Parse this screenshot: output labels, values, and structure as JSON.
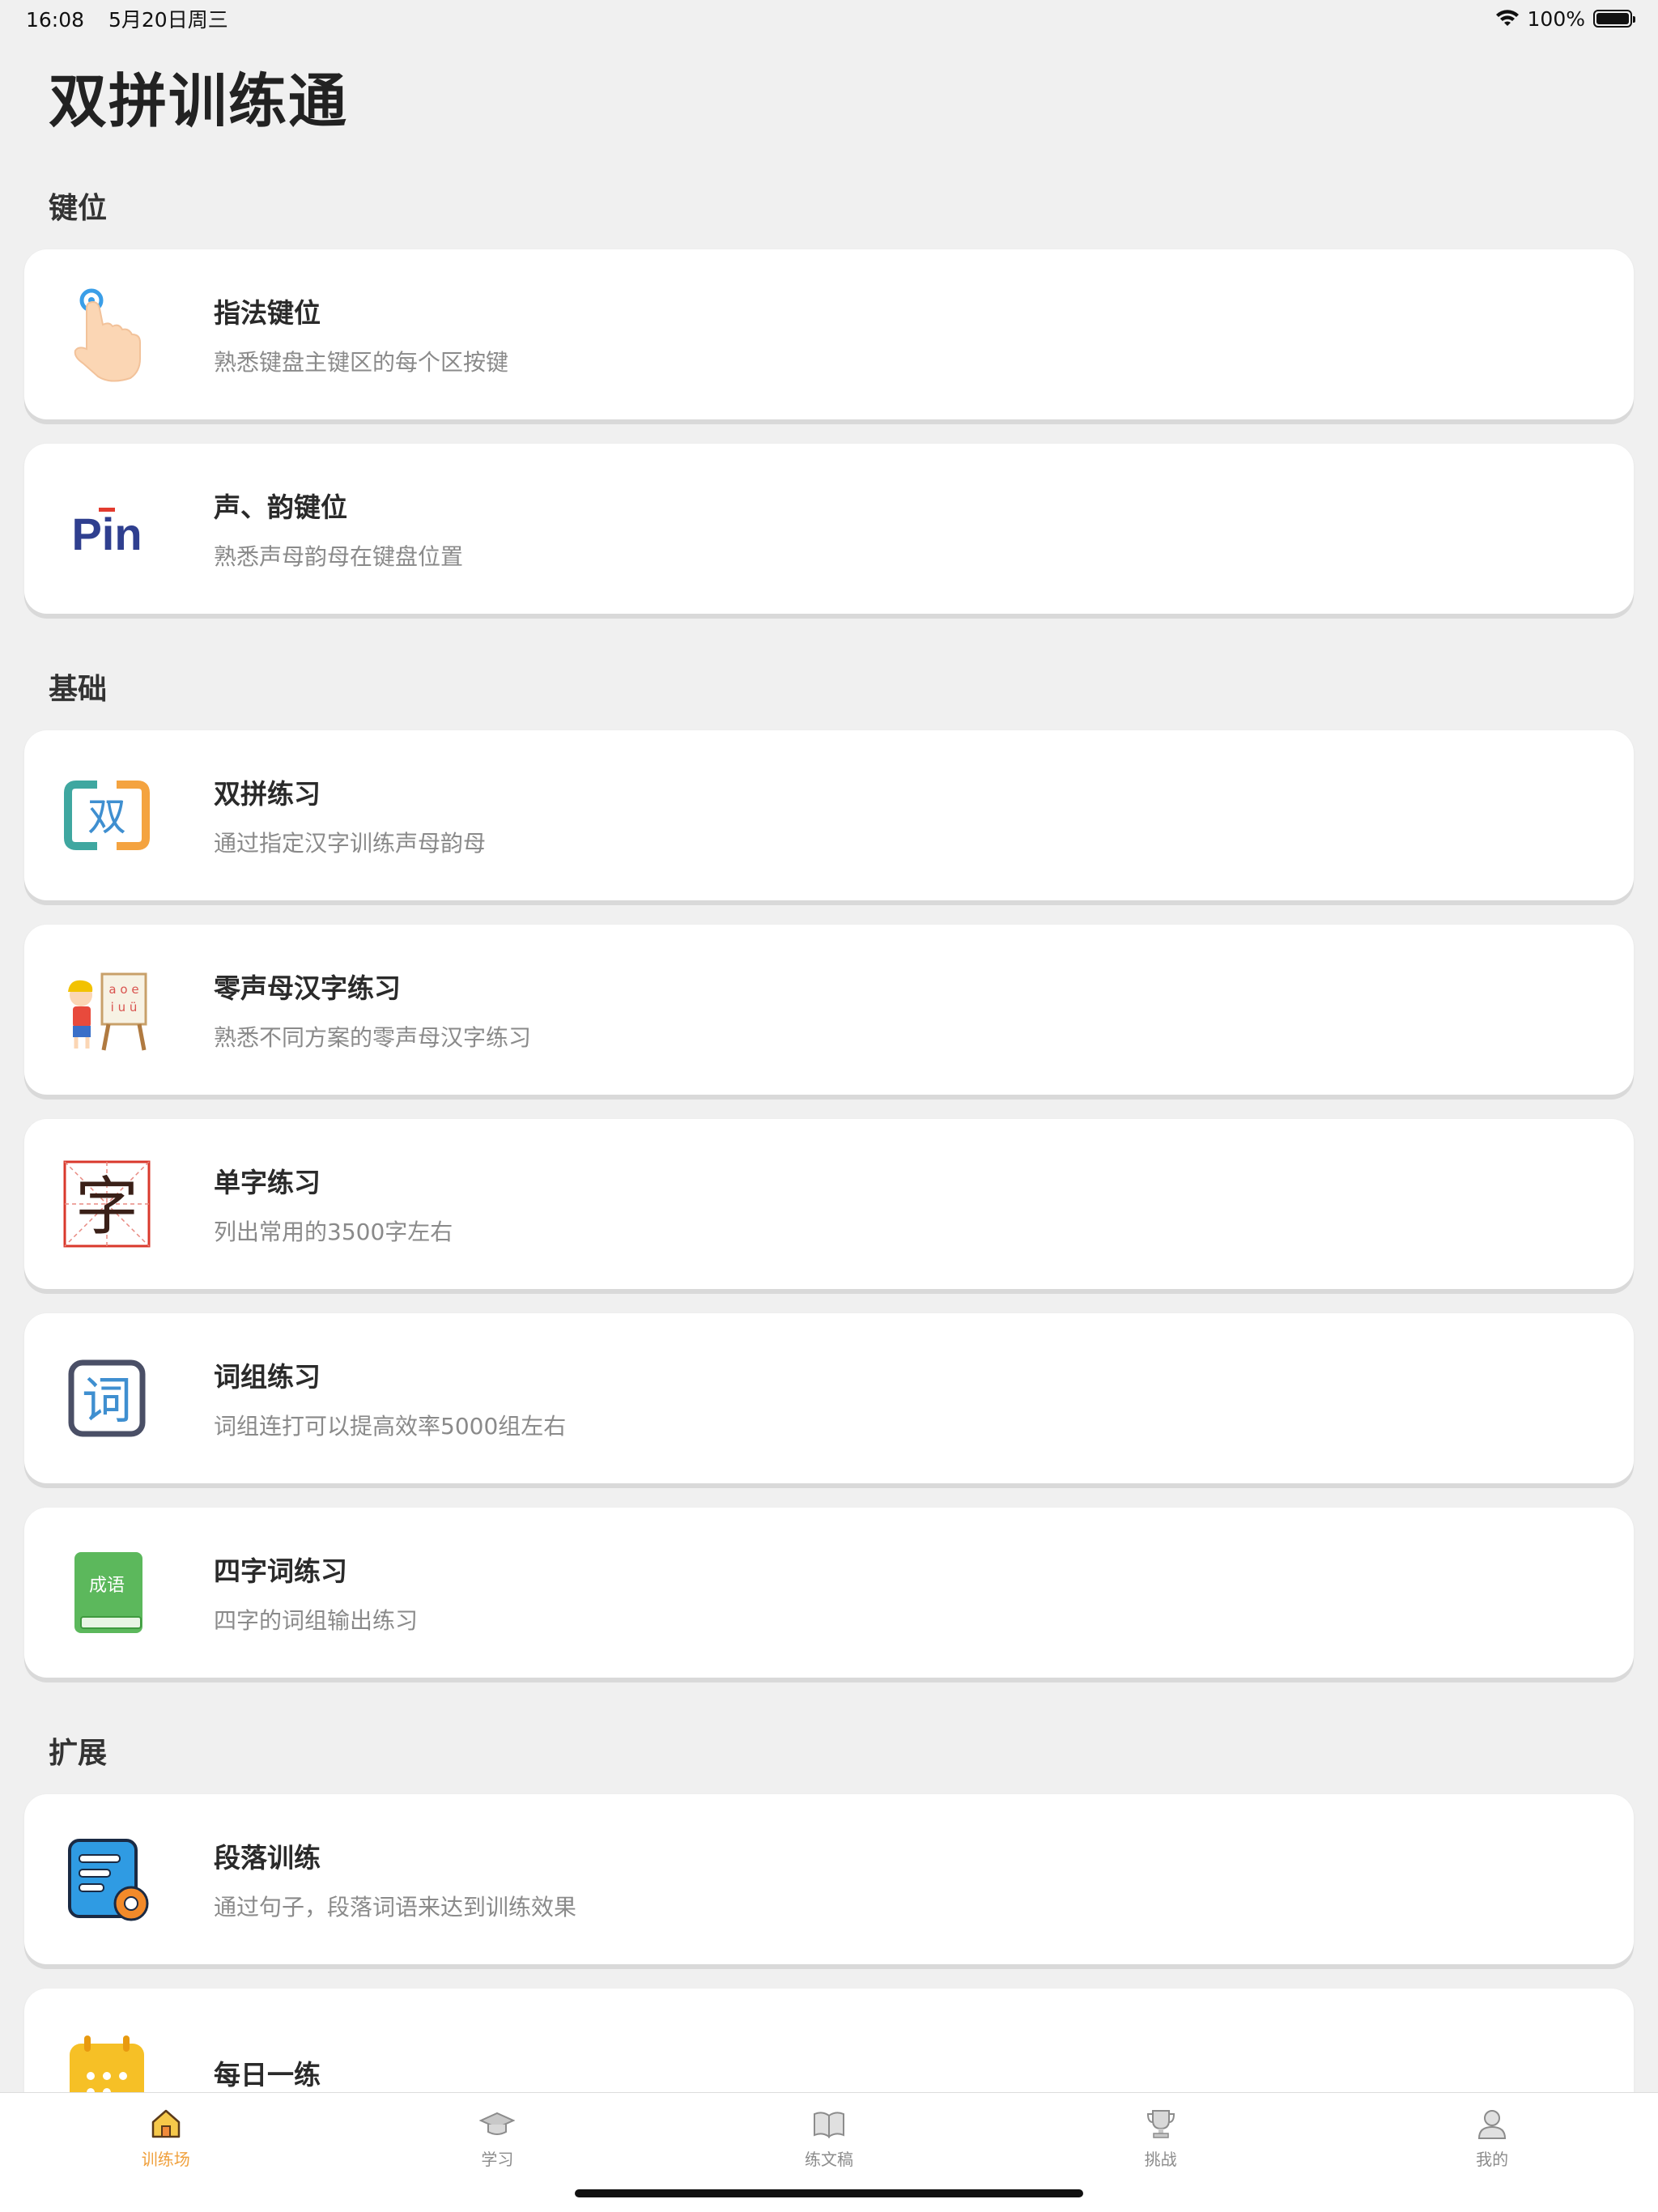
{
  "status": {
    "time": "16:08",
    "date": "5月20日周三",
    "battery": "100%"
  },
  "app": {
    "title": "双拼训练通"
  },
  "sections": {
    "keys": "键位",
    "basics": "基础",
    "extend": "扩展"
  },
  "cards": {
    "finger": {
      "title": "指法键位",
      "sub": "熟悉键盘主键区的每个区按键",
      "icon": "finger-tap-icon"
    },
    "initials": {
      "title": "声、韵键位",
      "sub": "熟悉声母韵母在键盘位置",
      "icon": "pin-logo-icon",
      "logo_text": "Pin"
    },
    "shuangpin": {
      "title": "双拼练习",
      "sub": "通过指定汉字训练声母韵母",
      "icon": "shuang-icon",
      "glyph": "双"
    },
    "zero": {
      "title": "零声母汉字练习",
      "sub": "熟悉不同方案的零声母汉字练习",
      "icon": "child-easel-icon",
      "easel_row1": "a o e",
      "easel_row2": "i u ü"
    },
    "single": {
      "title": "单字练习",
      "sub": "列出常用的3500字左右",
      "icon": "zi-grid-icon",
      "glyph": "字"
    },
    "phrase": {
      "title": "词组练习",
      "sub": "词组连打可以提高效率5000组左右",
      "icon": "ci-icon",
      "glyph": "词"
    },
    "idiom": {
      "title": "四字词练习",
      "sub": "四字的词组输出练习",
      "icon": "idiom-book-icon",
      "glyph": "成语"
    },
    "paragraph": {
      "title": "段落训练",
      "sub": "通过句子，段落词语来达到训练效果",
      "icon": "document-gear-icon"
    },
    "daily": {
      "title": "每日一练",
      "icon": "calendar-icon"
    }
  },
  "tabs": [
    {
      "label": "训练场",
      "icon": "home-icon",
      "active": true
    },
    {
      "label": "学习",
      "icon": "graduation-cap-icon",
      "active": false
    },
    {
      "label": "练文稿",
      "icon": "open-book-icon",
      "active": false
    },
    {
      "label": "挑战",
      "icon": "trophy-icon",
      "active": false
    },
    {
      "label": "我的",
      "icon": "user-icon",
      "active": false
    }
  ],
  "colors": {
    "accent": "#f0a03c",
    "background": "#f0f0f0",
    "card": "#ffffff"
  }
}
